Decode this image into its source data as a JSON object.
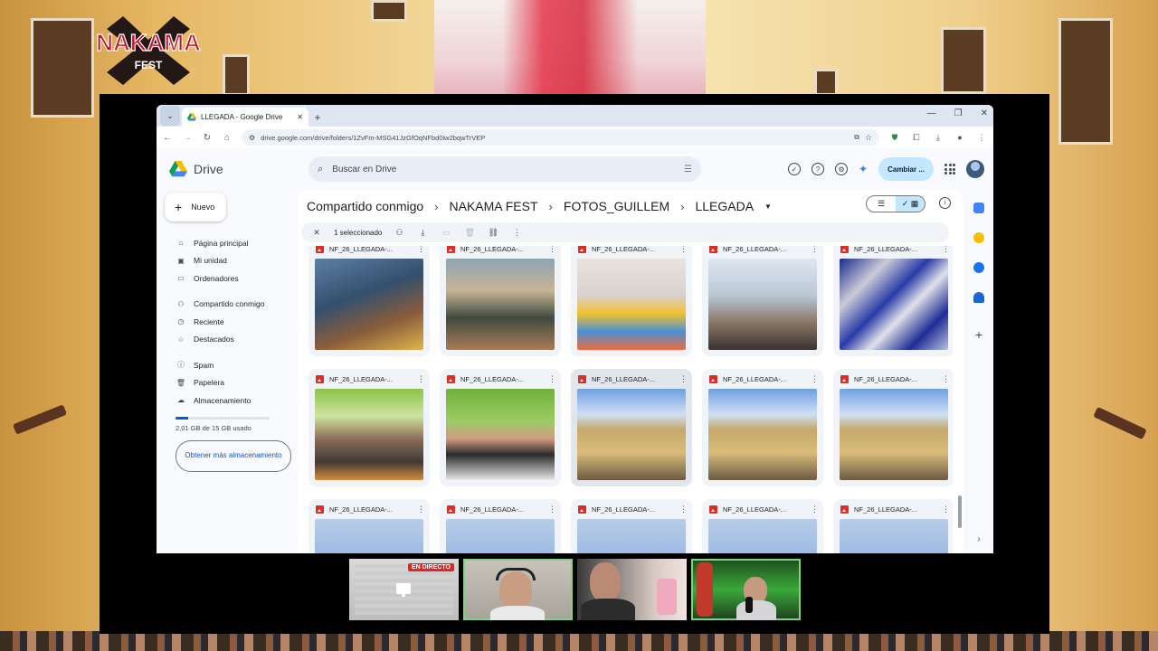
{
  "festival": {
    "logo_line1": "NAKAMA",
    "logo_line2": "FEST",
    "logo_color": "#c8112a"
  },
  "browser": {
    "tab_title": "LLEGADA - Google Drive",
    "url": "drive.google.com/drive/folders/1ZvFm-MSG41JzGfOqNFbd0iw2bqwTrVEP"
  },
  "drive": {
    "app_name": "Drive",
    "search_placeholder": "Buscar en Drive",
    "switch_label": "Cambiar ...",
    "new_label": "Nuevo",
    "nav": [
      {
        "label": "Página principal",
        "icon": "home-icon"
      },
      {
        "label": "Mi unidad",
        "icon": "my-drive-icon"
      },
      {
        "label": "Ordenadores",
        "icon": "computers-icon"
      },
      {
        "label": "Compartido conmigo",
        "icon": "shared-icon"
      },
      {
        "label": "Reciente",
        "icon": "clock-icon"
      },
      {
        "label": "Destacados",
        "icon": "star-icon"
      },
      {
        "label": "Spam",
        "icon": "spam-icon"
      },
      {
        "label": "Papelera",
        "icon": "trash-icon"
      },
      {
        "label": "Almacenamiento",
        "icon": "cloud-icon"
      }
    ],
    "storage": {
      "used_text": "2,01 GB de 15 GB usado",
      "used_fraction": 0.134,
      "more_label": "Obtener más almacenamiento"
    },
    "breadcrumbs": [
      "Compartido conmigo",
      "NAKAMA FEST",
      "FOTOS_GUILLEM",
      "LLEGADA"
    ],
    "selection": {
      "count_label": "1 seleccionado"
    },
    "files": [
      {
        "name": "NF_26_LLEGADA-...",
        "scene": "table"
      },
      {
        "name": "NF_26_LLEGADA-...",
        "scene": "stall"
      },
      {
        "name": "NF_26_LLEGADA-...",
        "scene": "plush"
      },
      {
        "name": "NF_26_LLEGADA-...",
        "scene": "hall"
      },
      {
        "name": "NF_26_LLEGADA-...",
        "scene": "cans"
      },
      {
        "name": "NF_26_LLEGADA-...",
        "scene": "crowd"
      },
      {
        "name": "NF_26_LLEGADA-...",
        "scene": "portrait"
      },
      {
        "name": "NF_26_LLEGADA-...",
        "scene": "courtyard"
      },
      {
        "name": "NF_26_LLEGADA-...",
        "scene": "courtyard"
      },
      {
        "name": "NF_26_LLEGADA-...",
        "scene": "courtyard"
      },
      {
        "name": "NF_26_LLEGADA-...",
        "scene": "sky"
      },
      {
        "name": "NF_26_LLEGADA-...",
        "scene": "sky"
      },
      {
        "name": "NF_26_LLEGADA-...",
        "scene": "sky"
      },
      {
        "name": "NF_26_LLEGADA-...",
        "scene": "sky"
      },
      {
        "name": "NF_26_LLEGADA-...",
        "scene": "sky"
      }
    ]
  },
  "stream": {
    "live_label": "EN DIRECTO"
  }
}
